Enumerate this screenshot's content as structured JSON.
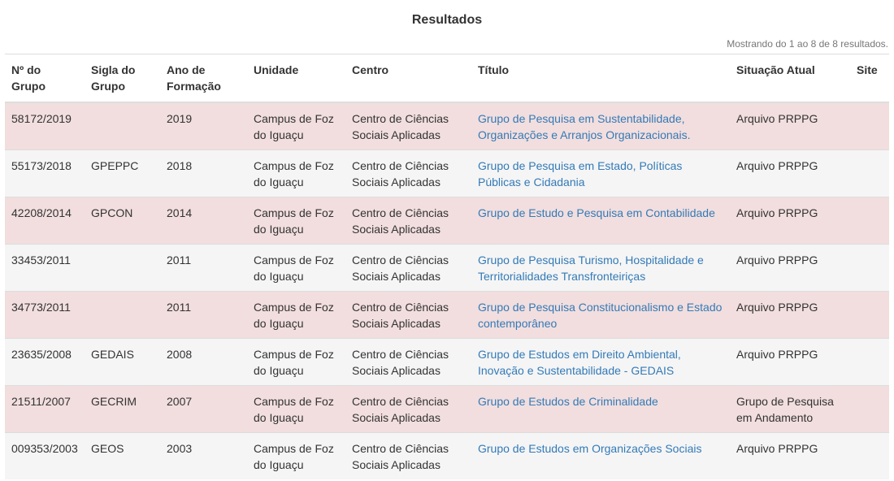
{
  "page": {
    "title": "Resultados",
    "results_count": "Mostrando do 1 ao 8 de 8 resultados."
  },
  "table": {
    "headers": {
      "numero": "Nº do Grupo",
      "sigla": "Sigla do Grupo",
      "ano": "Ano de Formação",
      "unidade": "Unidade",
      "centro": "Centro",
      "titulo": "Título",
      "situacao": "Situação Atual",
      "site": "Site"
    },
    "rows": [
      {
        "numero": "58172/2019",
        "sigla": "",
        "ano": "2019",
        "unidade": "Campus de Foz do Iguaçu",
        "centro": "Centro de Ciências Sociais Aplicadas",
        "titulo": "Grupo de Pesquisa em Sustentabilidade, Organizações e Arranjos Organizacionais.",
        "situacao": "Arquivo PRPPG",
        "site": ""
      },
      {
        "numero": "55173/2018",
        "sigla": "GPEPPC",
        "ano": "2018",
        "unidade": "Campus de Foz do Iguaçu",
        "centro": "Centro de Ciências Sociais Aplicadas",
        "titulo": "Grupo de Pesquisa em Estado, Políticas Públicas e Cidadania",
        "situacao": "Arquivo PRPPG",
        "site": ""
      },
      {
        "numero": "42208/2014",
        "sigla": "GPCON",
        "ano": "2014",
        "unidade": "Campus de Foz do Iguaçu",
        "centro": "Centro de Ciências Sociais Aplicadas",
        "titulo": "Grupo de Estudo e Pesquisa em Contabilidade",
        "situacao": "Arquivo PRPPG",
        "site": ""
      },
      {
        "numero": "33453/2011",
        "sigla": "",
        "ano": "2011",
        "unidade": "Campus de Foz do Iguaçu",
        "centro": "Centro de Ciências Sociais Aplicadas",
        "titulo": "Grupo de Pesquisa Turismo, Hospitalidade e Territorialidades Transfronteiriças",
        "situacao": "Arquivo PRPPG",
        "site": ""
      },
      {
        "numero": "34773/2011",
        "sigla": "",
        "ano": "2011",
        "unidade": "Campus de Foz do Iguaçu",
        "centro": "Centro de Ciências Sociais Aplicadas",
        "titulo": "Grupo de Pesquisa Constitucionalismo e Estado contemporâneo",
        "situacao": "Arquivo PRPPG",
        "site": ""
      },
      {
        "numero": "23635/2008",
        "sigla": "GEDAIS",
        "ano": "2008",
        "unidade": "Campus de Foz do Iguaçu",
        "centro": "Centro de Ciências Sociais Aplicadas",
        "titulo": "Grupo de Estudos em Direito Ambiental, Inovação e Sustentabilidade - GEDAIS",
        "situacao": "Arquivo PRPPG",
        "site": ""
      },
      {
        "numero": "21511/2007",
        "sigla": "GECRIM",
        "ano": "2007",
        "unidade": "Campus de Foz do Iguaçu",
        "centro": "Centro de Ciências Sociais Aplicadas",
        "titulo": "Grupo de Estudos de Criminalidade",
        "situacao": "Grupo de Pesquisa em Andamento",
        "site": ""
      },
      {
        "numero": "009353/2003",
        "sigla": "GEOS",
        "ano": "2003",
        "unidade": "Campus de Foz do Iguaçu",
        "centro": "Centro de Ciências Sociais Aplicadas",
        "titulo": "Grupo de Estudos em Organizações Sociais",
        "situacao": "Arquivo PRPPG",
        "site": ""
      }
    ]
  },
  "colors": {
    "link": "#337ab7",
    "row_highlight": "#f2dede",
    "row_alt": "#f5f5f5",
    "text": "#333333",
    "muted": "#777777"
  }
}
